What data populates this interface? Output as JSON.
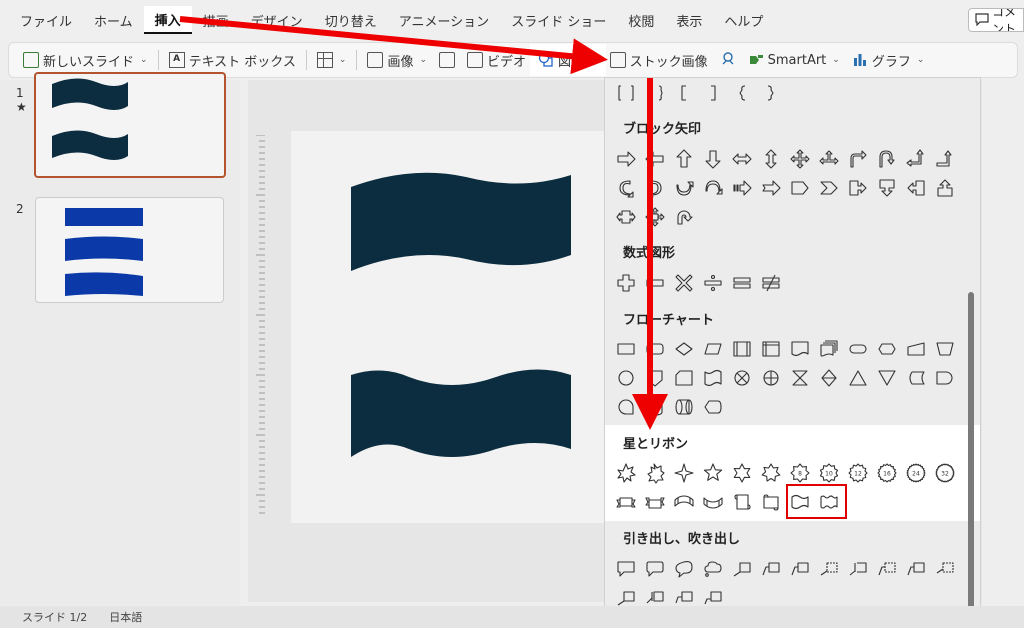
{
  "menu": {
    "items": [
      "ファイル",
      "ホーム",
      "挿入",
      "描画",
      "デザイン",
      "切り替え",
      "アニメーション",
      "スライド ショー",
      "校閲",
      "表示",
      "ヘルプ"
    ],
    "active_index": 2,
    "comment_label": "コメント"
  },
  "ribbon": {
    "new_slide": "新しいスライド",
    "text_box": "テキスト ボックス",
    "image": "画像",
    "video": "ビデオ",
    "shapes": "図形",
    "stock_images": "ストック画像",
    "smartart": "SmartArt",
    "chart": "グラフ"
  },
  "thumbnails": [
    {
      "number": "1",
      "star": "★",
      "selected": true
    },
    {
      "number": "2",
      "selected": false
    }
  ],
  "gallery": {
    "sections": [
      {
        "title": "",
        "shapes": [
          "left-right-bracket-pair-icon",
          "brace-pair-icon",
          "left-bracket-icon",
          "right-bracket-icon",
          "left-brace-icon",
          "right-brace-icon"
        ]
      },
      {
        "title": "ブロック矢印",
        "shapes": [
          "arrow-right-icon",
          "arrow-left-icon",
          "arrow-up-icon",
          "arrow-down-icon",
          "arrow-left-right-icon",
          "arrow-up-down-icon",
          "quad-arrow-icon",
          "left-right-up-arrow-icon",
          "bent-arrow-icon",
          "u-turn-arrow-icon",
          "left-up-arrow-icon",
          "bent-up-arrow-icon",
          "curved-right-arrow-icon",
          "curved-left-arrow-icon",
          "curved-up-arrow-icon",
          "curved-down-arrow-icon",
          "striped-right-arrow-icon",
          "notched-right-arrow-icon",
          "pentagon-arrow-icon",
          "chevron-arrow-icon",
          "right-arrow-callout-icon",
          "down-arrow-callout-icon",
          "left-arrow-callout-icon",
          "up-arrow-callout-icon",
          "left-right-arrow-callout-icon",
          "quad-arrow-callout-icon",
          "circular-arrow-icon"
        ]
      },
      {
        "title": "数式図形",
        "shapes": [
          "plus-icon",
          "minus-icon",
          "multiply-icon",
          "divide-icon",
          "equal-icon",
          "not-equal-icon"
        ]
      },
      {
        "title": "フローチャート",
        "shapes": [
          "process-icon",
          "alternate-process-icon",
          "decision-icon",
          "data-icon",
          "predefined-process-icon",
          "internal-storage-icon",
          "document-icon",
          "multidocument-icon",
          "terminator-icon",
          "preparation-icon",
          "manual-input-icon",
          "manual-operation-icon",
          "connector-icon",
          "offpage-connector-icon",
          "card-icon",
          "punched-tape-icon",
          "summing-junction-icon",
          "or-icon",
          "collate-icon",
          "sort-icon",
          "extract-icon",
          "merge-icon",
          "stored-data-icon",
          "delay-icon",
          "sequential-access-storage-icon",
          "magnetic-disk-icon",
          "direct-access-storage-icon",
          "display-icon"
        ]
      },
      {
        "title": "星とリボン",
        "shapes": [
          "explosion-1-icon",
          "explosion-2-icon",
          "star-4-icon",
          "star-5-icon",
          "star-6-icon",
          "star-7-icon",
          "star-8-icon",
          "star-10-icon",
          "star-12-icon",
          "star-16-icon",
          "star-24-icon",
          "star-32-icon",
          "ribbon-up-icon",
          "ribbon-down-icon",
          "curved-ribbon-up-icon",
          "curved-ribbon-down-icon",
          "vertical-scroll-icon",
          "horizontal-scroll-icon",
          "wave-icon",
          "double-wave-icon"
        ]
      },
      {
        "title": "引き出し、吹き出し",
        "shapes": [
          "rect-callout-icon",
          "rounded-rect-callout-icon",
          "oval-callout-icon",
          "cloud-callout-icon",
          "line-callout-1-icon",
          "line-callout-2-icon",
          "line-callout-3-icon",
          "line-callout-4-icon",
          "line-callout-accent-1-icon",
          "line-callout-accent-2-icon",
          "line-callout-accent-3-icon",
          "line-callout-accent-4-icon",
          "line-callout-border-1-icon",
          "line-callout-border-2-icon",
          "line-callout-border-3-icon",
          "line-callout-border-4-icon"
        ]
      }
    ],
    "star_badges": [
      "8",
      "10",
      "12",
      "16",
      "24",
      "32"
    ]
  },
  "status": {
    "slide_indicator": "スライド 1/2",
    "language": "日本語"
  },
  "colors": {
    "wave_fill": "#0c2d3f",
    "thumb_blue": "#0b3aa8",
    "highlight_red": "#e00000",
    "arrow_red": "#ee0000"
  }
}
